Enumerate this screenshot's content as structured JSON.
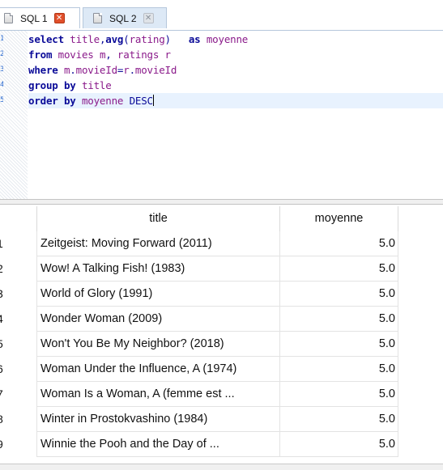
{
  "tabs": [
    {
      "label": "SQL 1",
      "active": true,
      "close_icon": "close-icon-red"
    },
    {
      "label": "SQL 2",
      "active": false,
      "close_icon": "close-icon-grey"
    }
  ],
  "editor": {
    "line_numbers": [
      "1",
      "2",
      "3",
      "4",
      "5"
    ],
    "lines": [
      {
        "tokens": [
          {
            "t": "select",
            "c": "kw"
          },
          {
            "t": " ",
            "c": ""
          },
          {
            "t": "title",
            "c": "id"
          },
          {
            "t": ",",
            "c": "op"
          },
          {
            "t": "avg",
            "c": "fn"
          },
          {
            "t": "(",
            "c": "op"
          },
          {
            "t": "rating",
            "c": "id"
          },
          {
            "t": ")",
            "c": "op"
          },
          {
            "t": "   ",
            "c": ""
          },
          {
            "t": "as",
            "c": "kw"
          },
          {
            "t": " ",
            "c": ""
          },
          {
            "t": "moyenne",
            "c": "id"
          }
        ]
      },
      {
        "tokens": [
          {
            "t": "from",
            "c": "kw"
          },
          {
            "t": " ",
            "c": ""
          },
          {
            "t": "movies",
            "c": "id"
          },
          {
            "t": " ",
            "c": ""
          },
          {
            "t": "m",
            "c": "id"
          },
          {
            "t": ", ",
            "c": "op"
          },
          {
            "t": "ratings",
            "c": "id"
          },
          {
            "t": " ",
            "c": ""
          },
          {
            "t": "r",
            "c": "id"
          }
        ]
      },
      {
        "tokens": [
          {
            "t": "where",
            "c": "kw"
          },
          {
            "t": " ",
            "c": ""
          },
          {
            "t": "m",
            "c": "id"
          },
          {
            "t": ".",
            "c": "op"
          },
          {
            "t": "movieId",
            "c": "id"
          },
          {
            "t": "=",
            "c": "op"
          },
          {
            "t": "r",
            "c": "id"
          },
          {
            "t": ".",
            "c": "op"
          },
          {
            "t": "movieId",
            "c": "id"
          }
        ]
      },
      {
        "tokens": [
          {
            "t": "group",
            "c": "kw"
          },
          {
            "t": " ",
            "c": ""
          },
          {
            "t": "by",
            "c": "kw"
          },
          {
            "t": " ",
            "c": ""
          },
          {
            "t": "title",
            "c": "id"
          }
        ]
      },
      {
        "tokens": [
          {
            "t": "order",
            "c": "kw"
          },
          {
            "t": " ",
            "c": ""
          },
          {
            "t": "by",
            "c": "kw"
          },
          {
            "t": " ",
            "c": ""
          },
          {
            "t": "moyenne",
            "c": "id"
          },
          {
            "t": " ",
            "c": ""
          },
          {
            "t": "DESC",
            "c": "kw-plain"
          }
        ]
      }
    ],
    "current_line": 5
  },
  "results": {
    "columns": [
      "title",
      "moyenne"
    ],
    "rows": [
      {
        "n": "1",
        "title": "Zeitgeist: Moving Forward (2011)",
        "moyenne": "5.0"
      },
      {
        "n": "2",
        "title": "Wow! A Talking Fish! (1983)",
        "moyenne": "5.0"
      },
      {
        "n": "3",
        "title": "World of Glory (1991)",
        "moyenne": "5.0"
      },
      {
        "n": "4",
        "title": "Wonder Woman (2009)",
        "moyenne": "5.0"
      },
      {
        "n": "5",
        "title": "Won't You Be My Neighbor? (2018)",
        "moyenne": "5.0"
      },
      {
        "n": "6",
        "title": "Woman Under the Influence, A (1974)",
        "moyenne": "5.0"
      },
      {
        "n": "7",
        "title": "Woman Is a Woman, A (femme est ...",
        "moyenne": "5.0"
      },
      {
        "n": "8",
        "title": "Winter in Prostokvashino (1984)",
        "moyenne": "5.0"
      },
      {
        "n": "9",
        "title": "Winnie the Pooh and the Day of ...",
        "moyenne": "5.0"
      }
    ]
  },
  "colors": {
    "keyword": "#0b0b98",
    "identifier": "#8a1a8a",
    "tab_active_close": "#e1502b",
    "tab_inactive_bg": "#dde9f6",
    "current_line_bg": "#e8f2fe"
  }
}
